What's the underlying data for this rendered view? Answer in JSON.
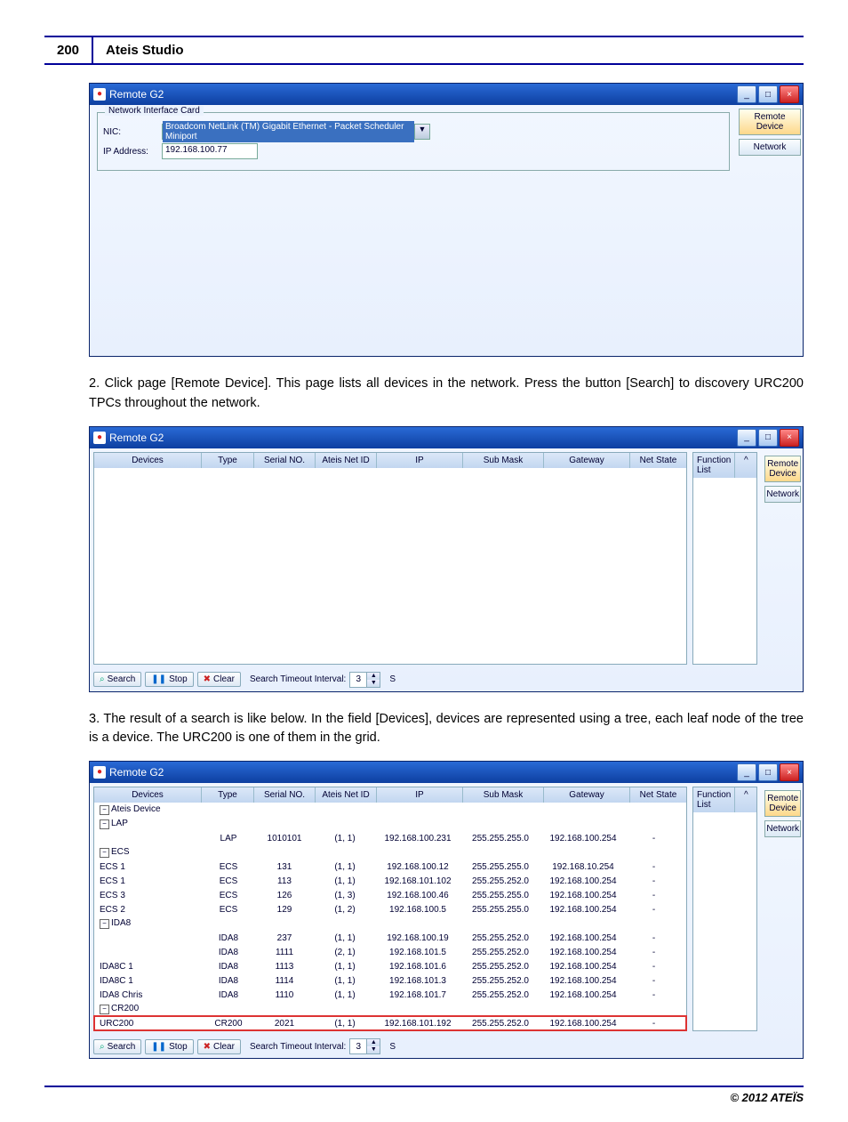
{
  "page": {
    "number": "200",
    "title": "Ateis Studio",
    "footer": "© 2012 ATEÏS"
  },
  "text": {
    "step2": "2.  Click page [Remote Device]. This page lists all devices in the network. Press the button [Search] to discovery URC200 TPCs throughout the network.",
    "step3": "3.  The result of a search is like below. In the field [Devices], devices are represented using a tree, each leaf node of the tree is a device. The URC200 is one of them in the grid."
  },
  "win": {
    "title": "Remote G2",
    "side_remote": "Remote Device",
    "side_network": "Network"
  },
  "nic": {
    "legend": "Network Interface Card",
    "nic_label": "NIC:",
    "nic_value": "Broadcom NetLink (TM) Gigabit Ethernet - Packet Scheduler Miniport",
    "ip_label": "IP Address:",
    "ip_value": "192.168.100.77"
  },
  "grid": {
    "h_dev": "Devices",
    "h_typ": "Type",
    "h_ser": "Serial NO.",
    "h_anet": "Ateis Net ID",
    "h_ip": "IP",
    "h_sub": "Sub Mask",
    "h_gw": "Gateway",
    "h_ns": "Net State",
    "h_fl": "Function List",
    "caret": "^",
    "root": "Ateis Device",
    "lap_node": "LAP",
    "ecs_node": "ECS",
    "idab_node": "IDA8",
    "cr_node": "CR200",
    "rows": [
      {
        "dev": "",
        "typ": "LAP",
        "ser": "1010101",
        "anet": "(1, 1)",
        "ip": "192.168.100.231",
        "sub": "255.255.255.0",
        "gw": "192.168.100.254",
        "ns": "-"
      },
      {
        "dev": "ECS 1",
        "typ": "ECS",
        "ser": "131",
        "anet": "(1, 1)",
        "ip": "192.168.100.12",
        "sub": "255.255.255.0",
        "gw": "192.168.10.254",
        "ns": "-"
      },
      {
        "dev": "ECS 1",
        "typ": "ECS",
        "ser": "113",
        "anet": "(1, 1)",
        "ip": "192.168.101.102",
        "sub": "255.255.252.0",
        "gw": "192.168.100.254",
        "ns": "-"
      },
      {
        "dev": "ECS 3",
        "typ": "ECS",
        "ser": "126",
        "anet": "(1, 3)",
        "ip": "192.168.100.46",
        "sub": "255.255.255.0",
        "gw": "192.168.100.254",
        "ns": "-"
      },
      {
        "dev": "ECS 2",
        "typ": "ECS",
        "ser": "129",
        "anet": "(1, 2)",
        "ip": "192.168.100.5",
        "sub": "255.255.255.0",
        "gw": "192.168.100.254",
        "ns": "-"
      },
      {
        "dev": "",
        "typ": "IDA8",
        "ser": "237",
        "anet": "(1, 1)",
        "ip": "192.168.100.19",
        "sub": "255.255.252.0",
        "gw": "192.168.100.254",
        "ns": "-"
      },
      {
        "dev": "",
        "typ": "IDA8",
        "ser": "1111",
        "anet": "(2, 1)",
        "ip": "192.168.101.5",
        "sub": "255.255.252.0",
        "gw": "192.168.100.254",
        "ns": "-"
      },
      {
        "dev": "IDA8C 1",
        "typ": "IDA8",
        "ser": "1113",
        "anet": "(1, 1)",
        "ip": "192.168.101.6",
        "sub": "255.255.252.0",
        "gw": "192.168.100.254",
        "ns": "-"
      },
      {
        "dev": "IDA8C 1",
        "typ": "IDA8",
        "ser": "1114",
        "anet": "(1, 1)",
        "ip": "192.168.101.3",
        "sub": "255.255.252.0",
        "gw": "192.168.100.254",
        "ns": "-"
      },
      {
        "dev": "IDA8 Chris",
        "typ": "IDA8",
        "ser": "1110",
        "anet": "(1, 1)",
        "ip": "192.168.101.7",
        "sub": "255.255.252.0",
        "gw": "192.168.100.254",
        "ns": "-"
      },
      {
        "dev": "URC200",
        "typ": "CR200",
        "ser": "2021",
        "anet": "(1, 1)",
        "ip": "192.168.101.192",
        "sub": "255.255.252.0",
        "gw": "192.168.100.254",
        "ns": "-"
      }
    ]
  },
  "toolbar": {
    "search": "Search",
    "stop": "Stop",
    "clear": "Clear",
    "label": "Search Timeout Interval:",
    "val": "3",
    "unit": "S"
  }
}
